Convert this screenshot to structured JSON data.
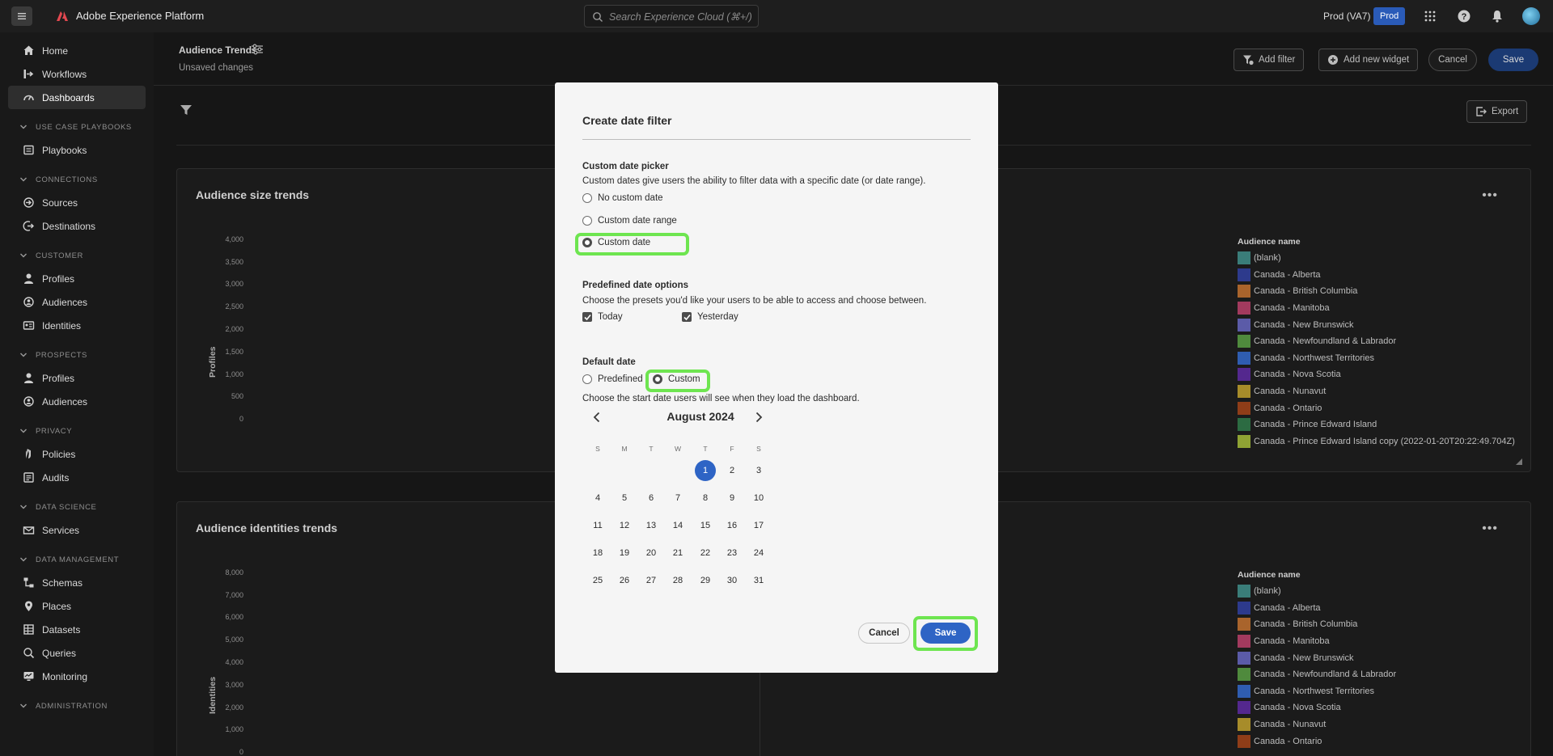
{
  "topbar": {
    "app_name": "Adobe Experience Platform",
    "search_placeholder": "Search Experience Cloud (⌘+/)",
    "org": "Prod (VA7)",
    "sandbox_badge": "Prod"
  },
  "sidebar": {
    "items_top": [
      {
        "label": "Home",
        "icon": "home-icon"
      },
      {
        "label": "Workflows",
        "icon": "workflows-icon"
      },
      {
        "label": "Dashboards",
        "icon": "dashboards-icon"
      }
    ],
    "sections": [
      {
        "title": "USE CASE PLAYBOOKS",
        "items": [
          {
            "label": "Playbooks",
            "icon": "playbooks-icon"
          }
        ]
      },
      {
        "title": "CONNECTIONS",
        "items": [
          {
            "label": "Sources",
            "icon": "sources-icon"
          },
          {
            "label": "Destinations",
            "icon": "destinations-icon"
          }
        ]
      },
      {
        "title": "CUSTOMER",
        "items": [
          {
            "label": "Profiles",
            "icon": "profiles-icon"
          },
          {
            "label": "Audiences",
            "icon": "audiences-icon"
          },
          {
            "label": "Identities",
            "icon": "identities-icon"
          }
        ]
      },
      {
        "title": "PROSPECTS",
        "items": [
          {
            "label": "Profiles",
            "icon": "profiles-icon"
          },
          {
            "label": "Audiences",
            "icon": "audiences-icon"
          }
        ]
      },
      {
        "title": "PRIVACY",
        "items": [
          {
            "label": "Policies",
            "icon": "policies-icon"
          },
          {
            "label": "Audits",
            "icon": "audits-icon"
          }
        ]
      },
      {
        "title": "DATA SCIENCE",
        "items": [
          {
            "label": "Services",
            "icon": "services-icon"
          }
        ]
      },
      {
        "title": "DATA MANAGEMENT",
        "items": [
          {
            "label": "Schemas",
            "icon": "schemas-icon"
          },
          {
            "label": "Places",
            "icon": "places-icon"
          },
          {
            "label": "Datasets",
            "icon": "datasets-icon"
          },
          {
            "label": "Queries",
            "icon": "queries-icon"
          },
          {
            "label": "Monitoring",
            "icon": "monitoring-icon"
          }
        ]
      },
      {
        "title": "ADMINISTRATION",
        "items": []
      }
    ]
  },
  "header": {
    "title": "Audience Trends",
    "subtitle": "Unsaved changes",
    "add_filter": "Add filter",
    "add_widget": "Add new widget",
    "cancel": "Cancel",
    "save": "Save",
    "export": "Export"
  },
  "cards": [
    {
      "title": "Audience size trends",
      "y_title": "Profiles",
      "y_ticks": [
        "4,000",
        "3,500",
        "3,000",
        "2,500",
        "2,000",
        "1,500",
        "1,000",
        "500",
        "0"
      ],
      "legend_title": "Audience name",
      "legend": [
        {
          "label": "(blank)",
          "color": "#3a7d79"
        },
        {
          "label": "Canada - Alberta",
          "color": "#2d3a8c"
        },
        {
          "label": "Canada - British Columbia",
          "color": "#a9642c"
        },
        {
          "label": "Canada - Manitoba",
          "color": "#a23a5e"
        },
        {
          "label": "Canada - New Brunswick",
          "color": "#5b5ba8"
        },
        {
          "label": "Canada - Newfoundland & Labrador",
          "color": "#4f8a3d"
        },
        {
          "label": "Canada - Northwest Territories",
          "color": "#2f5db0"
        },
        {
          "label": "Canada - Nova Scotia",
          "color": "#54288e"
        },
        {
          "label": "Canada - Nunavut",
          "color": "#a78c2a"
        },
        {
          "label": "Canada - Ontario",
          "color": "#8f3d18"
        },
        {
          "label": "Canada - Prince Edward Island",
          "color": "#2c6b42"
        },
        {
          "label": "Canada - Prince Edward Island copy (2022-01-20T20:22:49.704Z)",
          "color": "#8fa334"
        }
      ]
    },
    {
      "title": "Audience identities trends",
      "y_title": "Identities",
      "y_ticks": [
        "8,000",
        "7,000",
        "6,000",
        "5,000",
        "4,000",
        "3,000",
        "2,000",
        "1,000",
        "0"
      ],
      "legend_title": "Audience name",
      "legend": [
        {
          "label": "(blank)",
          "color": "#3a7d79"
        },
        {
          "label": "Canada - Alberta",
          "color": "#2d3a8c"
        },
        {
          "label": "Canada - British Columbia",
          "color": "#a9642c"
        },
        {
          "label": "Canada - Manitoba",
          "color": "#a23a5e"
        },
        {
          "label": "Canada - New Brunswick",
          "color": "#5b5ba8"
        },
        {
          "label": "Canada - Newfoundland & Labrador",
          "color": "#4f8a3d"
        },
        {
          "label": "Canada - Northwest Territories",
          "color": "#2f5db0"
        },
        {
          "label": "Canada - Nova Scotia",
          "color": "#54288e"
        },
        {
          "label": "Canada - Nunavut",
          "color": "#a78c2a"
        },
        {
          "label": "Canada - Ontario",
          "color": "#8f3d18"
        }
      ]
    }
  ],
  "modal": {
    "title": "Create date filter",
    "custom_picker": {
      "heading": "Custom date picker",
      "description": "Custom dates give users the ability to filter data with a specific date (or date range).",
      "options": [
        "No custom date",
        "Custom date range",
        "Custom date"
      ],
      "selected": "Custom date"
    },
    "predefined": {
      "heading": "Predefined date options",
      "description": "Choose the presets you'd like your users to be able to access and choose between.",
      "options": [
        {
          "label": "Today",
          "checked": true
        },
        {
          "label": "Yesterday",
          "checked": true
        }
      ]
    },
    "default_date": {
      "heading": "Default date",
      "options": [
        "Predefined",
        "Custom"
      ],
      "selected": "Custom",
      "description": "Choose the start date users will see when they load the dashboard."
    },
    "calendar": {
      "month_label": "August 2024",
      "weekdays": [
        "S",
        "M",
        "T",
        "W",
        "T",
        "F",
        "S"
      ],
      "first_weekday_index": 4,
      "days_in_month": 31,
      "selected_day": 1
    },
    "cancel": "Cancel",
    "save": "Save"
  },
  "highlight_color": "#6ee550",
  "accent_color": "#2e64c5"
}
